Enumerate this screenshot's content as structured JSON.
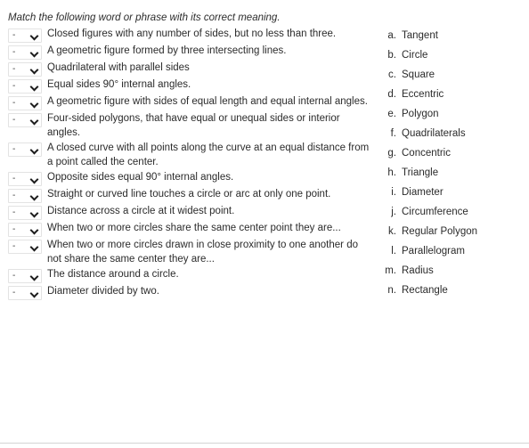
{
  "instructions": "Match the following word or phrase with its correct meaning.",
  "select": {
    "value": "-",
    "icon": "chevron-down-icon"
  },
  "questions": [
    {
      "text": "Closed figures with any number of sides, but no less than three."
    },
    {
      "text": "A geometric figure formed by three intersecting lines."
    },
    {
      "text": "Quadrilateral with parallel sides"
    },
    {
      "text": "Equal sides 90° internal angles."
    },
    {
      "text": "A geometric figure with sides of equal length and equal internal angles."
    },
    {
      "text": "Four-sided polygons, that have equal or unequal sides or interior angles."
    },
    {
      "text": "A closed curve with all points along the curve at an equal distance from a point called the center."
    },
    {
      "text": "Opposite sides equal 90° internal angles."
    },
    {
      "text": "Straight or curved line touches a circle or arc at only one point."
    },
    {
      "text": "Distance across a circle at it widest point."
    },
    {
      "text": "When two or more circles share the same center point they are..."
    },
    {
      "text": "When two or more circles drawn in close proximity to one another do not share the same center they are..."
    },
    {
      "text": "The distance around a circle."
    },
    {
      "text": "Diameter divided by two."
    }
  ],
  "options": [
    {
      "letter": "a.",
      "label": "Tangent"
    },
    {
      "letter": "b.",
      "label": "Circle"
    },
    {
      "letter": "c.",
      "label": "Square"
    },
    {
      "letter": "d.",
      "label": "Eccentric"
    },
    {
      "letter": "e.",
      "label": "Polygon"
    },
    {
      "letter": "f.",
      "label": "Quadrilaterals"
    },
    {
      "letter": "g.",
      "label": "Concentric"
    },
    {
      "letter": "h.",
      "label": "Triangle"
    },
    {
      "letter": "i.",
      "label": "Diameter"
    },
    {
      "letter": "j.",
      "label": "Circumference"
    },
    {
      "letter": "k.",
      "label": "Regular Polygon"
    },
    {
      "letter": "l.",
      "label": "Parallelogram"
    },
    {
      "letter": "m.",
      "label": "Radius"
    },
    {
      "letter": "n.",
      "label": "Rectangle"
    }
  ],
  "colors": {
    "text": "#2b2b2b",
    "border": "#e3e3e3",
    "rule": "#d4d4d4",
    "background": "#ffffff"
  }
}
